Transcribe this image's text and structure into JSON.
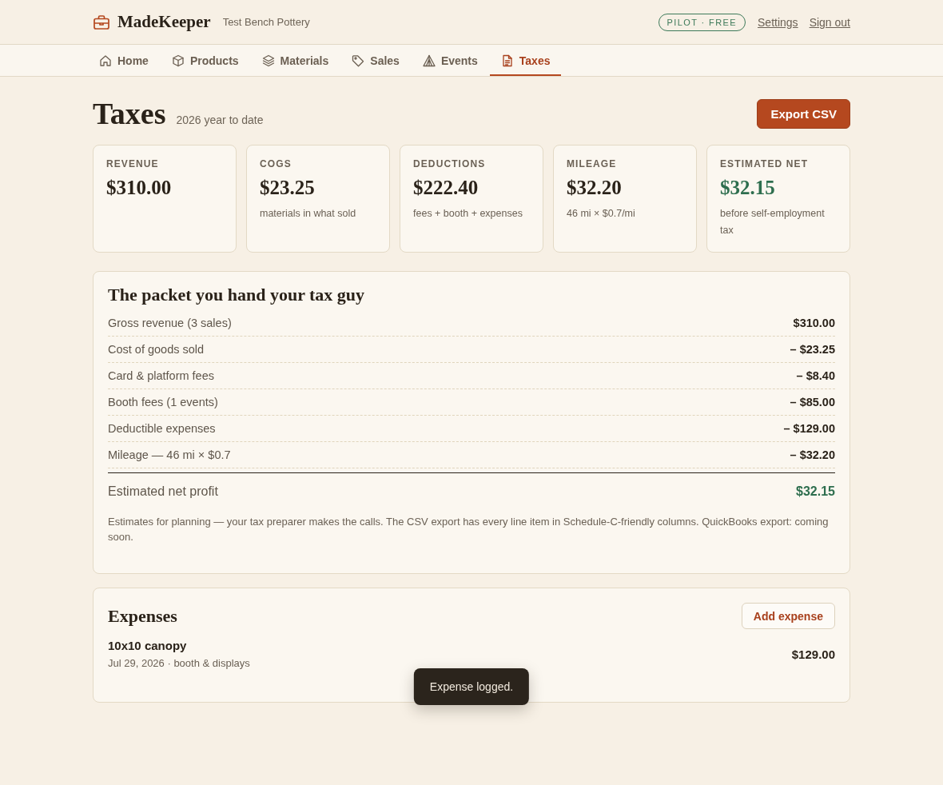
{
  "header": {
    "brand": "MadeKeeper",
    "workspace": "Test Bench Pottery",
    "plan_badge": "PILOT · FREE",
    "links": [
      "Settings",
      "Sign out"
    ]
  },
  "nav": {
    "tabs": [
      {
        "label": "Home",
        "selected": false
      },
      {
        "label": "Products",
        "selected": false
      },
      {
        "label": "Materials",
        "selected": false
      },
      {
        "label": "Sales",
        "selected": false
      },
      {
        "label": "Events",
        "selected": false
      },
      {
        "label": "Taxes",
        "selected": true
      }
    ]
  },
  "page": {
    "title": "Taxes",
    "subtitle": "2026 year to date",
    "export_button": "Export CSV"
  },
  "stats": [
    {
      "label": "REVENUE",
      "value": "$310.00",
      "highlighted": false
    },
    {
      "label": "COGS",
      "value": "$23.25",
      "note": "materials in what sold",
      "highlighted": false
    },
    {
      "label": "DEDUCTIONS",
      "value": "$222.40",
      "note": "fees + booth + expenses",
      "highlighted": false
    },
    {
      "label": "MILEAGE",
      "value": "$32.20",
      "note": "46 mi × $0.7/mi",
      "highlighted": false
    },
    {
      "label": "ESTIMATED NET",
      "value": "$32.15",
      "note": "before self-employment tax",
      "highlighted": true
    }
  ],
  "packet": {
    "title": "The packet you hand your tax guy",
    "lines": [
      {
        "label": "Gross revenue (3 sales)",
        "amount": "$310.00"
      },
      {
        "label": "Cost of goods sold",
        "amount": "– $23.25"
      },
      {
        "label": "Card & platform fees",
        "amount": "– $8.40"
      },
      {
        "label": "Booth fees (1 events)",
        "amount": "– $85.00"
      },
      {
        "label": "Deductible expenses",
        "amount": "– $129.00"
      },
      {
        "label": "Mileage — 46 mi × $0.7",
        "amount": "– $32.20"
      }
    ],
    "total": {
      "label": "Estimated net profit",
      "amount": "$32.15"
    },
    "note": "Estimates for planning — your tax preparer makes the calls. The CSV export has every line item in Schedule-C-friendly columns. QuickBooks export: coming soon."
  },
  "expenses": {
    "title": "Expenses",
    "add_button": "Add expense",
    "items": [
      {
        "name": "10x10 canopy",
        "meta": "Jul 29, 2026 · booth & displays",
        "amount": "$129.00"
      }
    ]
  },
  "toast": {
    "message": "Expense logged."
  }
}
